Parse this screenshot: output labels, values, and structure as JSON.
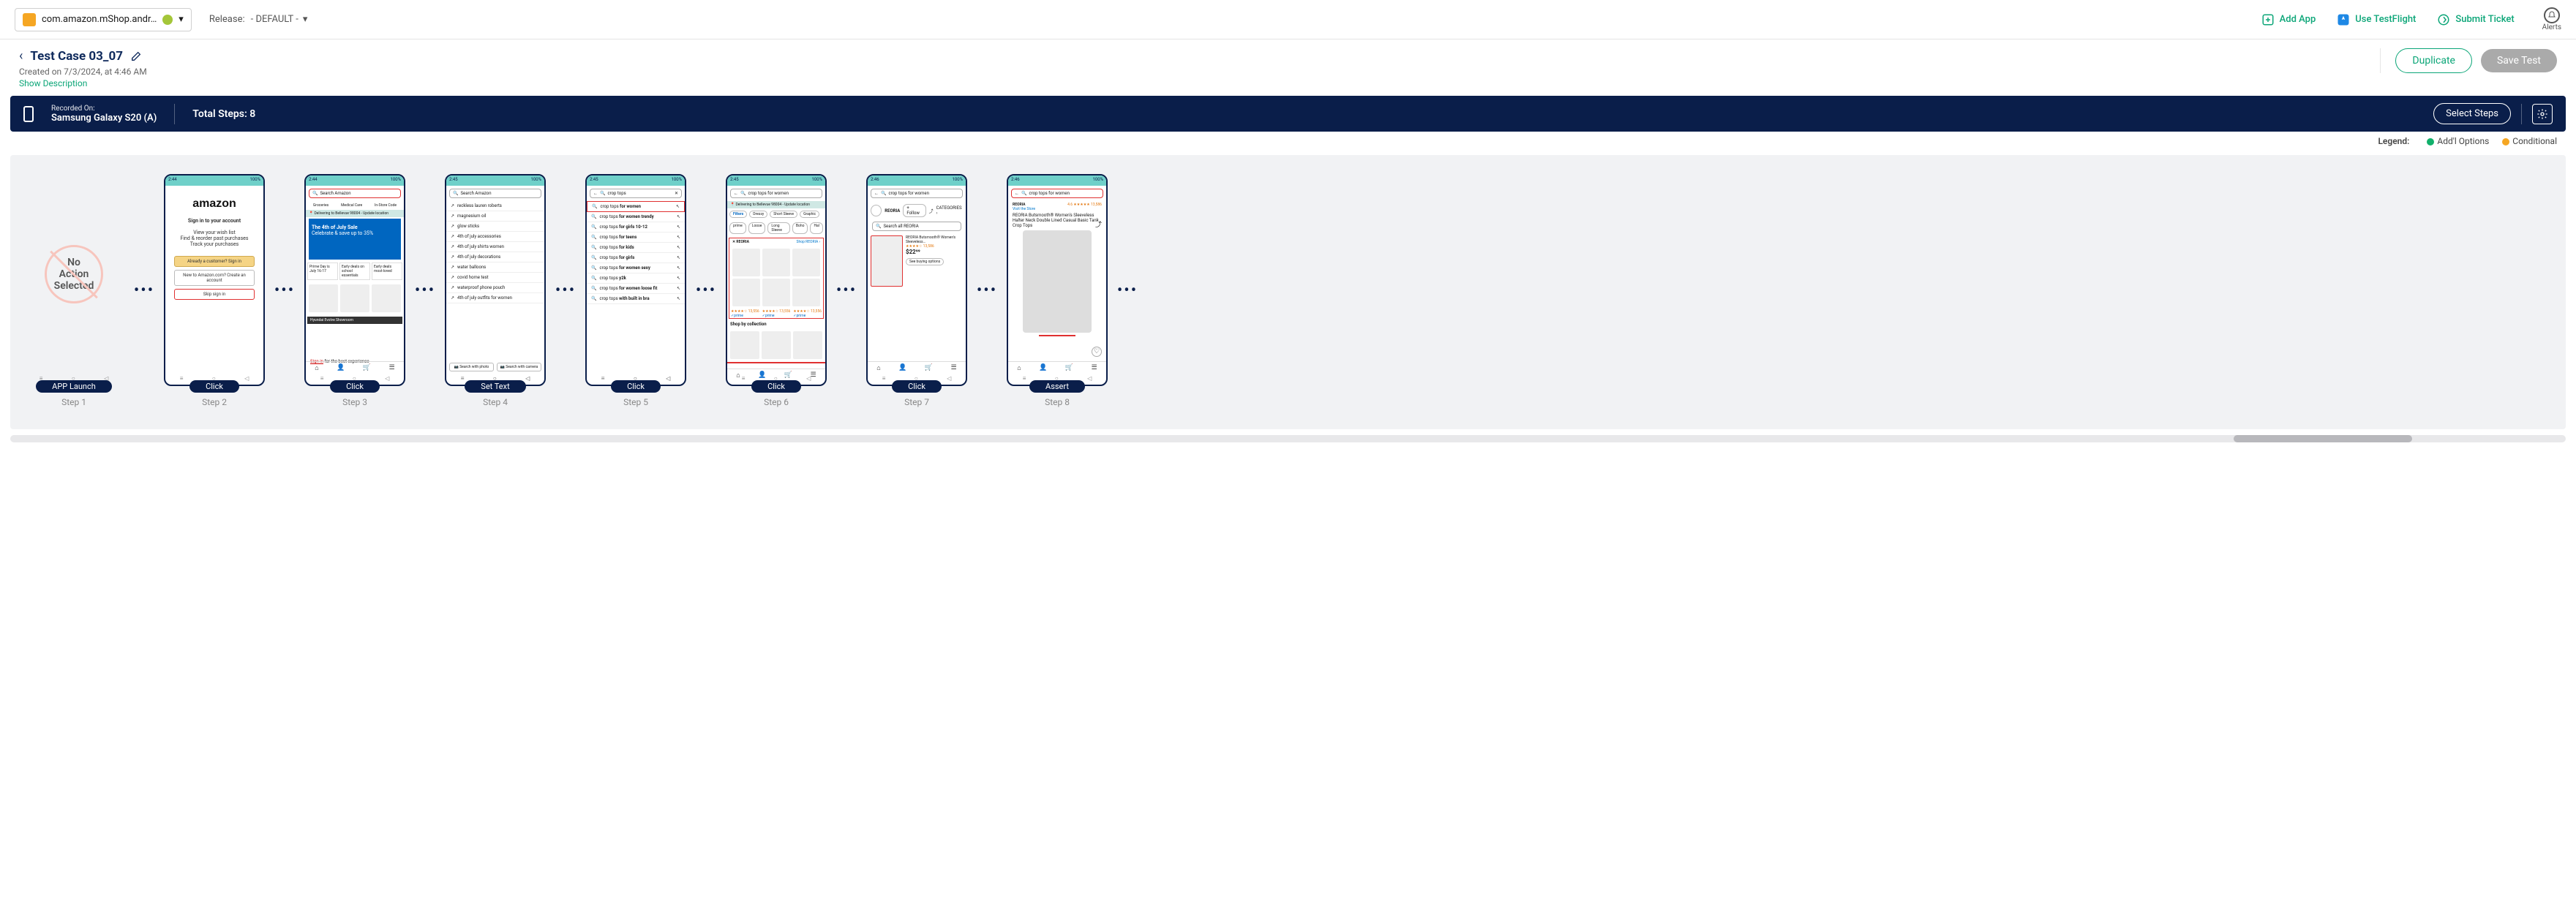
{
  "appSelector": {
    "name": "com.amazon.mShop.andr…",
    "platform": "android"
  },
  "release": {
    "label": "Release:",
    "value": "- DEFAULT -"
  },
  "topActions": {
    "addApp": "Add App",
    "useTestFlight": "Use TestFlight",
    "submitTicket": "Submit Ticket",
    "alerts": "Alerts"
  },
  "testCase": {
    "title": "Test Case 03_07",
    "createdOn": "Created on 7/3/2024, at 4:46 AM",
    "showDescription": "Show Description",
    "duplicateBtn": "Duplicate",
    "saveTestBtn": "Save Test"
  },
  "recBar": {
    "recordedOnLabel": "Recorded On:",
    "device": "Samsung Galaxy S20 (A)",
    "totalSteps": "Total Steps: 8",
    "selectSteps": "Select Steps"
  },
  "legend": {
    "label": "Legend:",
    "addl": "Add'l Options",
    "conditional": "Conditional"
  },
  "steps": [
    {
      "index": 1,
      "action": "APP Launch",
      "label": "Step 1",
      "noAction": true,
      "noActionText": "No\nAction\nSelected"
    },
    {
      "index": 2,
      "action": "Click",
      "label": "Step 2",
      "statusbar": {
        "left": "2:44",
        "right": "100%"
      },
      "content": {
        "type": "signin",
        "logo": "amazon",
        "heading": "Sign in to your account",
        "lines": [
          "View your wish list",
          "Find & reorder past purchases",
          "Track your purchases"
        ],
        "buttons": [
          {
            "text": "Already a customer? Sign in",
            "style": "gold"
          },
          {
            "text": "New to Amazon.com? Create an account",
            "style": "white"
          },
          {
            "text": "Skip sign in",
            "style": "red"
          }
        ]
      }
    },
    {
      "index": 3,
      "action": "Click",
      "label": "Step 3",
      "statusbar": {
        "left": "2:44",
        "right": "100%"
      },
      "content": {
        "type": "home",
        "search": {
          "placeholder": "Search Amazon",
          "highlight": true
        },
        "tabs": [
          "Groceries",
          "Medical Care",
          "In-Store Code"
        ],
        "deliverTo": "Delivering to Bellevue 98004 - Update location",
        "heroTitle": "The 4th of July Sale",
        "heroSub": "Celebrate & save up to 35%",
        "cards": [
          "Prime Day is July 16-17",
          "Early deals on school essentials",
          "Early deals most-loved"
        ],
        "banner": "Hyundai Evolve Showroom",
        "signInLine": "Sign in for the best experience"
      }
    },
    {
      "index": 4,
      "action": "Set Text",
      "label": "Step 4",
      "statusbar": {
        "left": "2:45",
        "right": "100%"
      },
      "content": {
        "type": "suggest",
        "search": {
          "placeholder": "Search Amazon",
          "highlight": false
        },
        "suggestions": [
          "reckless lauren roberts",
          "magnesium oil",
          "glow sticks",
          "4th of july accessories",
          "4th of july shirts women",
          "4th of july decorations",
          "water balloons",
          "covid home test",
          "waterproof phone pouch",
          "4th of july outfits for women"
        ],
        "bottomBtns": [
          "Search with photo",
          "Search with camera"
        ]
      }
    },
    {
      "index": 5,
      "action": "Click",
      "label": "Step 5",
      "statusbar": {
        "left": "2:45",
        "right": "100%"
      },
      "content": {
        "type": "suggest",
        "search": {
          "value": "crop tops",
          "highlight": false,
          "searchIcon": true
        },
        "suggestions": [
          {
            "prefix": "crop tops ",
            "bold": "for women",
            "highlight": true
          },
          {
            "prefix": "crop tops ",
            "bold": "for women trendy"
          },
          {
            "prefix": "crop tops ",
            "bold": "for girls 10-12"
          },
          {
            "prefix": "crop tops ",
            "bold": "for teens"
          },
          {
            "prefix": "crop tops ",
            "bold": "for kids"
          },
          {
            "prefix": "crop tops ",
            "bold": "for girls"
          },
          {
            "prefix": "crop tops ",
            "bold": "for women sexy"
          },
          {
            "prefix": "crop tops ",
            "bold": "y2k"
          },
          {
            "prefix": "crop tops ",
            "bold": "for women loose fit"
          },
          {
            "prefix": "crop tops ",
            "bold": "with built in bra"
          }
        ]
      }
    },
    {
      "index": 6,
      "action": "Click",
      "label": "Step 6",
      "statusbar": {
        "left": "2:45",
        "right": "100%"
      },
      "content": {
        "type": "results",
        "search": {
          "value": "crop tops for women",
          "highlight": false
        },
        "deliverTo": "Delivering to Bellevue 98004 - Update location",
        "filterRow": [
          "Filters",
          "Dressy",
          "Short Sleeve",
          "Graphic"
        ],
        "chipRow": [
          "prime",
          "Loose",
          "Long Sleeve",
          "Boho",
          "Hal"
        ],
        "brandBanner": {
          "brand": "REORIA",
          "link": "Shop REORIA ›"
        },
        "gridCount": 6,
        "priceHints": [
          "13,556",
          "13,556",
          "13,556"
        ],
        "section": "Shop by collection",
        "highlightResults": true
      }
    },
    {
      "index": 7,
      "action": "Click",
      "label": "Step 7",
      "statusbar": {
        "left": "2:46",
        "right": "100%"
      },
      "content": {
        "type": "brand",
        "search": {
          "value": "crop tops for women",
          "highlight": false
        },
        "brand": "REORIA",
        "follow": "+ Follow",
        "categories": "CATEGORIES ›",
        "searchBrand": "Search all REORIA",
        "prod": {
          "title": "REORIA Butsmooth® Women's Sleeveless…",
          "rating": "★★★★☆ 13,586",
          "price": "$22⁹⁹",
          "buying": "See buying options",
          "thumbHighlight": true
        }
      }
    },
    {
      "index": 8,
      "action": "Assert",
      "label": "Step 8",
      "statusbar": {
        "left": "2:46",
        "right": "100%"
      },
      "content": {
        "type": "product",
        "search": {
          "value": "crop tops for women",
          "highlight": true
        },
        "brand": "REORIA",
        "visitStore": "Visit the Store",
        "rating": "4.6 ★★★★★ 13,586",
        "title": "REORIA Butsmooth® Women's Sleeveless Halter Neck Double Lined Casual Basic Tank Crop Tops",
        "redHint": true
      }
    }
  ]
}
